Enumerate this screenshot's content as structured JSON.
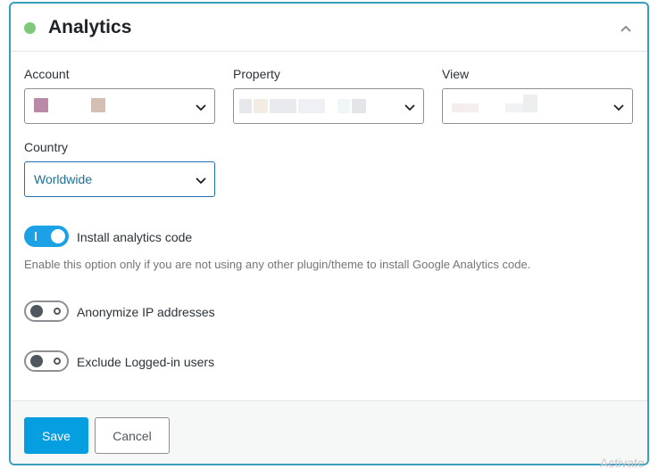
{
  "panel": {
    "title": "Analytics",
    "status_color": "#7ec97a",
    "collapse_icon": "chevron-up-icon"
  },
  "fields": {
    "account": {
      "label": "Account",
      "value": ""
    },
    "property": {
      "label": "Property",
      "value": ""
    },
    "view": {
      "label": "View",
      "value": ""
    },
    "country": {
      "label": "Country",
      "value": "Worldwide"
    }
  },
  "toggles": [
    {
      "label": "Install analytics code",
      "enabled": true
    },
    {
      "label": "Anonymize IP addresses",
      "enabled": false
    },
    {
      "label": "Exclude Logged-in users",
      "enabled": false
    }
  ],
  "help_text": "Enable this option only if you are not using any other plugin/theme to install Google Analytics code.",
  "footer": {
    "save_label": "Save",
    "cancel_label": "Cancel"
  },
  "watermark": "Activate",
  "colors": {
    "accent": "#049ee1",
    "toggle_on": "#1da1e6",
    "border": "#3a9fbf"
  }
}
